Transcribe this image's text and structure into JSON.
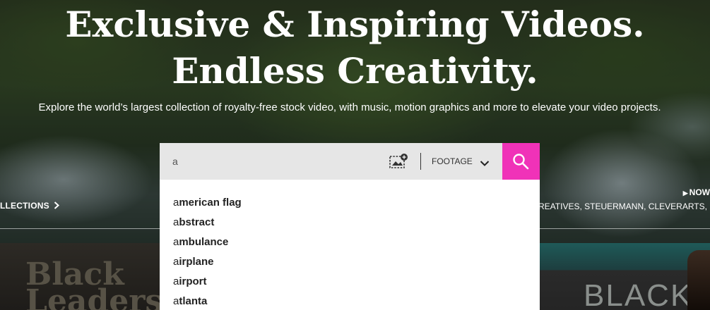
{
  "hero": {
    "headline_line1": "Exclusive & Inspiring Videos.",
    "headline_line2": "Endless Creativity.",
    "subtext": "Explore the world’s largest collection of royalty-free stock video, with music, motion graphics and more to elevate your video projects."
  },
  "search": {
    "query": "a",
    "type_label": "FOOTAGE",
    "accent_color": "#f032b8"
  },
  "suggestions": [
    {
      "typed": "a",
      "rest": "merican flag"
    },
    {
      "typed": "a",
      "rest": "bstract"
    },
    {
      "typed": "a",
      "rest": "mbulance"
    },
    {
      "typed": "a",
      "rest": "irplane"
    },
    {
      "typed": "a",
      "rest": "irport"
    },
    {
      "typed": "a",
      "rest": "tlanta"
    }
  ],
  "links": {
    "collections": "LLECTIONS",
    "now": "NOW",
    "partners": "REATIVES, STEUERMANN, CLEVERARTS, DA"
  },
  "thumbnails": {
    "left_title": "Black Leaders",
    "right_title": "BLACK"
  }
}
